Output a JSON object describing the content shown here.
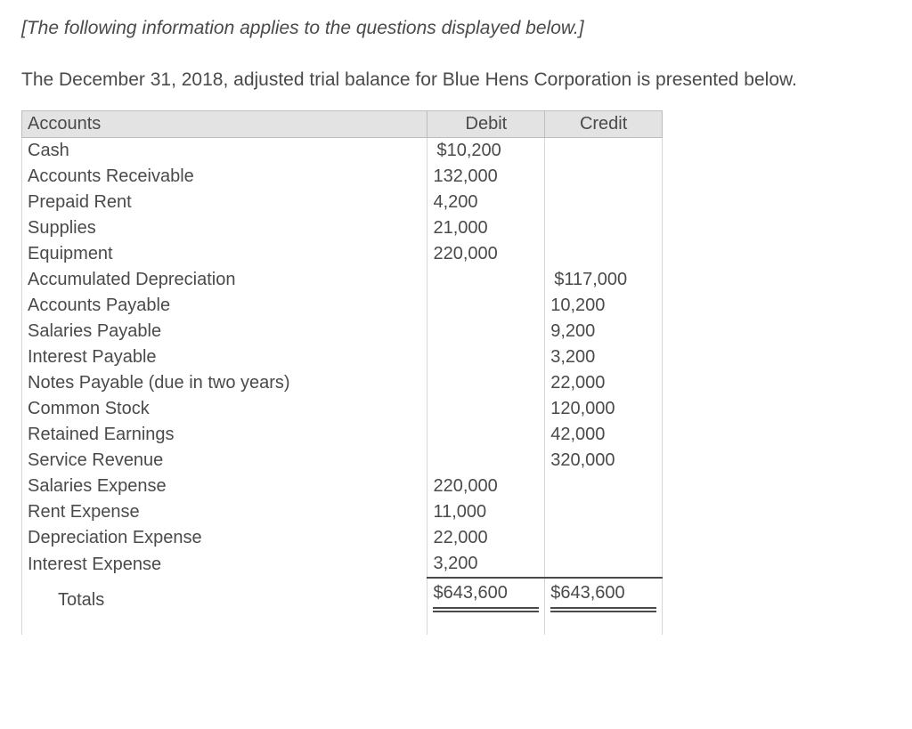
{
  "intro": "[The following information applies to the questions displayed below.]",
  "description": "The December 31, 2018, adjusted trial balance for Blue Hens Corporation is presented below.",
  "headers": {
    "accounts": "Accounts",
    "debit": "Debit",
    "credit": "Credit"
  },
  "rows": [
    {
      "name": "Cash",
      "debit": "10,200",
      "debit_dollar": true
    },
    {
      "name": "Accounts Receivable",
      "debit": "132,000"
    },
    {
      "name": "Prepaid Rent",
      "debit": "4,200"
    },
    {
      "name": "Supplies",
      "debit": "21,000"
    },
    {
      "name": "Equipment",
      "debit": "220,000"
    },
    {
      "name": "Accumulated Depreciation",
      "credit": "117,000",
      "credit_dollar": true
    },
    {
      "name": "Accounts Payable",
      "credit": "10,200"
    },
    {
      "name": "Salaries Payable",
      "credit": "9,200"
    },
    {
      "name": "Interest Payable",
      "credit": "3,200"
    },
    {
      "name": "Notes Payable (due in two years)",
      "credit": "22,000"
    },
    {
      "name": "Common Stock",
      "credit": "120,000"
    },
    {
      "name": "Retained Earnings",
      "credit": "42,000"
    },
    {
      "name": "Service Revenue",
      "credit": "320,000"
    },
    {
      "name": "Salaries Expense",
      "debit": "220,000"
    },
    {
      "name": "Rent Expense",
      "debit": "11,000"
    },
    {
      "name": "Depreciation Expense",
      "debit": "22,000"
    },
    {
      "name": "Interest Expense",
      "debit": "3,200"
    }
  ],
  "totals": {
    "label": "Totals",
    "debit": "$643,600",
    "credit": "$643,600"
  },
  "chart_data": {
    "type": "table",
    "title": "Adjusted Trial Balance — Blue Hens Corporation — December 31, 2018",
    "columns": [
      "Accounts",
      "Debit",
      "Credit"
    ],
    "rows": [
      [
        "Cash",
        10200,
        null
      ],
      [
        "Accounts Receivable",
        132000,
        null
      ],
      [
        "Prepaid Rent",
        4200,
        null
      ],
      [
        "Supplies",
        21000,
        null
      ],
      [
        "Equipment",
        220000,
        null
      ],
      [
        "Accumulated Depreciation",
        null,
        117000
      ],
      [
        "Accounts Payable",
        null,
        10200
      ],
      [
        "Salaries Payable",
        null,
        9200
      ],
      [
        "Interest Payable",
        null,
        3200
      ],
      [
        "Notes Payable (due in two years)",
        null,
        22000
      ],
      [
        "Common Stock",
        null,
        120000
      ],
      [
        "Retained Earnings",
        null,
        42000
      ],
      [
        "Service Revenue",
        null,
        320000
      ],
      [
        "Salaries Expense",
        220000,
        null
      ],
      [
        "Rent Expense",
        11000,
        null
      ],
      [
        "Depreciation Expense",
        22000,
        null
      ],
      [
        "Interest Expense",
        3200,
        null
      ]
    ],
    "totals": {
      "debit": 643600,
      "credit": 643600
    }
  }
}
